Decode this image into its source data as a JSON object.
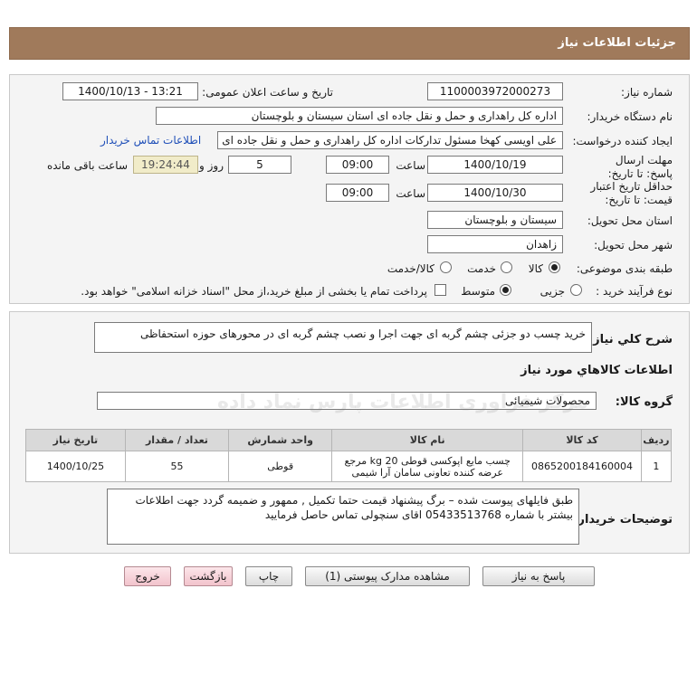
{
  "page": {
    "title": "جزئیات اطلاعات نیاز"
  },
  "info": {
    "need_number_label": "شماره نیاز:",
    "need_number": "1100003972000273",
    "announce_label": "تاریخ و ساعت اعلان عمومی:",
    "announce_value": "1400/10/13 - 13:21",
    "buyer_org_label": "نام دستگاه خریدار:",
    "buyer_org": "اداره کل راهداری و حمل و نقل جاده ای استان سیستان و بلوچستان",
    "creator_label": "ایجاد کننده درخواست:",
    "creator": "علی اویسی کهخا مسئول تدارکات اداره کل راهداری و حمل و نقل جاده ای است",
    "contact_link": "اطلاعات تماس خریدار",
    "reply_deadline_label": "مهلت ارسال پاسخ: تا تاریخ:",
    "reply_date": "1400/10/19",
    "time_label": "ساعت",
    "reply_time": "09:00",
    "days_value": "5",
    "days_label": "روز و",
    "remaining_time": "19:24:44",
    "remaining_label": "ساعت باقی مانده",
    "validity_label": "حداقل تاریخ اعتبار قیمت: تا تاریخ:",
    "validity_date": "1400/10/30",
    "validity_time_label": "ساعت",
    "validity_time": "09:00",
    "province_label": "استان محل تحویل:",
    "province": "سیستان و بلوچستان",
    "city_label": "شهر محل تحویل:",
    "city": "زاهدان",
    "category_label": "طبقه بندی موضوعی:",
    "category_options": [
      "کالا",
      "خدمت",
      "کالا/خدمت"
    ],
    "category_selected": "کالا",
    "process_label": "نوع فرآیند خرید :",
    "process_options": [
      "جزیی",
      "متوسط"
    ],
    "process_selected": "متوسط",
    "payment_note": "پرداخت تمام یا بخشی از مبلغ خرید،از محل \"اسناد خزانه اسلامی\" خواهد بود."
  },
  "need": {
    "summary_label": "شرح کلي نياز:",
    "summary": "خرید چسب دو جزئی چشم گربه ای جهت اجرا و نصب چشم گربه ای در محورهای حوزه استحفاظی",
    "goods_info_title": "اطلاعات كالاهاي مورد نياز",
    "goods_group_label": "گروه کالا:",
    "goods_group": "محصولات شیمیائی",
    "table": {
      "headers": [
        "ردیف",
        "کد کالا",
        "نام کالا",
        "واحد شمارش",
        "تعداد / مقدار",
        "تاریخ نیاز"
      ],
      "rows": [
        {
          "index": "1",
          "code": "0865200184160004",
          "name": "چسب مایع اپوکسی قوطی kg 20 مرجع عرضه کننده تعاونی سامان آرا شیمی",
          "unit": "قوطی",
          "qty": "55",
          "date": "1400/10/25"
        }
      ]
    },
    "buyer_notes_label": "توضیحات خریدار:",
    "buyer_notes": "طبق فایلهای پیوست شده – برگ پیشنهاد قیمت حتما تکمیل , ممهور و ضمیمه گردد جهت اطلاعات بیشتر با شماره 05433513768 اقای سنچولی تماس حاصل فرمایید"
  },
  "buttons": {
    "reply": "پاسخ به نیاز",
    "attachments": "مشاهده مدارک پیوستی (1)",
    "print": "چاپ",
    "back": "بازگشت",
    "exit": "خروج"
  }
}
